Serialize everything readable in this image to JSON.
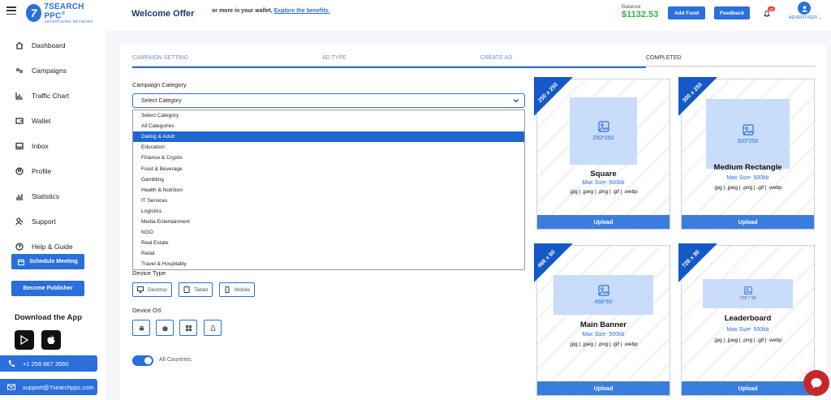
{
  "brand": {
    "name": "7SEARCH PPC",
    "reg": "®",
    "tagline": "ADVERTISING NETWORK",
    "badge": "7"
  },
  "sidebar": {
    "items": [
      {
        "label": "Dashboard",
        "icon": "home-icon"
      },
      {
        "label": "Campaigns",
        "icon": "campaigns-icon"
      },
      {
        "label": "Traffic Chart",
        "icon": "chart-icon"
      },
      {
        "label": "Wallet",
        "icon": "wallet-icon"
      },
      {
        "label": "Inbox",
        "icon": "inbox-icon"
      },
      {
        "label": "Profile",
        "icon": "profile-icon"
      },
      {
        "label": "Statistics",
        "icon": "statistics-icon"
      },
      {
        "label": "Support",
        "icon": "support-icon"
      },
      {
        "label": "Help & Guide",
        "icon": "help-icon"
      }
    ],
    "schedule_meeting": "Schedule Meeting",
    "become_publisher": "Become Publisher",
    "download_title": "Download the App",
    "phone": "+1 256 667 3560",
    "email": "support@7searchppc.com"
  },
  "header": {
    "welcome": "Welcome Offer",
    "wallet_msg": "or more in your wallet,",
    "explore_link": "Explore the benefits.",
    "balance_label": "Balance",
    "balance_value": "$1132.53",
    "add_fund": "Add Fund",
    "feedback": "Feedback",
    "notif_count": "29",
    "role": "ADVERTISER"
  },
  "steps": [
    "CAMPAIGN SETTING",
    "AD TYPE",
    "CREATE AD",
    "COMPLETED"
  ],
  "form": {
    "category_label": "Campaign Category",
    "category_selected": "Select Category",
    "category_options": [
      "Select Category",
      "All Categories",
      "Dating & Adult",
      "Education",
      "Finance & Crypto",
      "Food & Beverage",
      "Gambling",
      "Health & Nutrition",
      "IT Services",
      "Logistics",
      "Media Entertainment",
      "NGO",
      "Real Estate",
      "Retail",
      "Travel & Hospitality"
    ],
    "highlighted_option": "Dating & Adult",
    "device_type_label": "Device Type",
    "devices": [
      "Desktop",
      "Tablet",
      "Mobile"
    ],
    "device_os_label": "Device OS",
    "os": [
      "android-icon",
      "apple-icon",
      "windows-icon",
      "linux-icon"
    ],
    "countries_label": "All Countries",
    "countries_toggle": true
  },
  "ads": [
    {
      "ribbon": "250 x 250",
      "name": "Square",
      "placeholder": "250*250",
      "max": "Max Size- 500kb",
      "formats": ".jpg | .jpeg | .png | .gif | .webp",
      "upload": "Upload"
    },
    {
      "ribbon": "300 x 250",
      "name": "Medium Rectangle",
      "placeholder": "300*250",
      "max": "Max Size- 500kb",
      "formats": ".jpg | .jpeg | .png | .gif | .webp",
      "upload": "Upload"
    },
    {
      "ribbon": "468 x 60",
      "name": "Main Banner",
      "placeholder": "468*60",
      "max": "Max Size- 500kb",
      "formats": ".jpg | .jpeg | .png | .gif | .webp",
      "upload": "Upload"
    },
    {
      "ribbon": "728 x 90",
      "name": "Leaderboard",
      "placeholder": "728 * 90",
      "max": "Max Size- 500kb",
      "formats": ".jpg | .jpeg | .png | .gif | .webp",
      "upload": "Upload"
    }
  ],
  "colors": {
    "primary": "#2a6fdb",
    "ribbon": "#1459c7",
    "balance": "#2fb344",
    "chat": "#c62828"
  }
}
